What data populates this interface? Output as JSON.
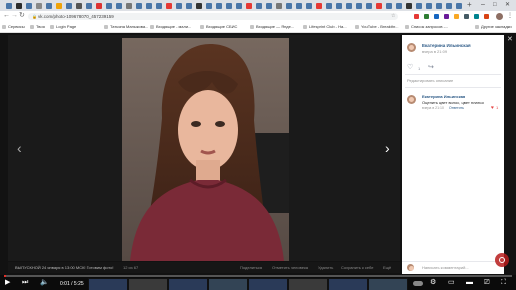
{
  "browser": {
    "url": "vk.com/photo-109678070_457239159",
    "bookmarks": [
      "Сервисы",
      "Твоя",
      "Login Page",
      "Татьяна Маныкова...",
      "Входящие - мали...",
      "Входящие СБИС",
      "Входящие — Янде...",
      "Lifesprint Club - На...",
      "YouTube - Breakthr...",
      "Список запросов -...",
      "Другие закладки"
    ]
  },
  "photo_viewer": {
    "caption": "ВЫПУСКНОЙ 24 января в 13:00 МСК! Готовим фото!",
    "counter": "12 из 67",
    "actions": [
      "Поделиться",
      "Отметить человека",
      "Удалить",
      "Сохранить к себе",
      "Ещё"
    ],
    "prev_label": "‹",
    "next_label": "›",
    "close_label": "✕"
  },
  "sidepanel": {
    "author": "Екатерина Ильинская",
    "date": "вчера в 21:09",
    "like_count": "1",
    "editor_note": "Редактировать описание",
    "comments": [
      {
        "author": "Екатерина Ильинская",
        "text": "Оценить цвет волос, цвет платья",
        "date": "вчера в 21:10",
        "reply": "Ответить",
        "likes": "1"
      }
    ],
    "comment_placeholder": "Написать комментарий..."
  },
  "video": {
    "time": "0:01 / 5:25",
    "progress": 0.003
  },
  "colors": {
    "accent": "#2a5885",
    "like_red": "#e64646",
    "progress_red": "#e52d27"
  }
}
